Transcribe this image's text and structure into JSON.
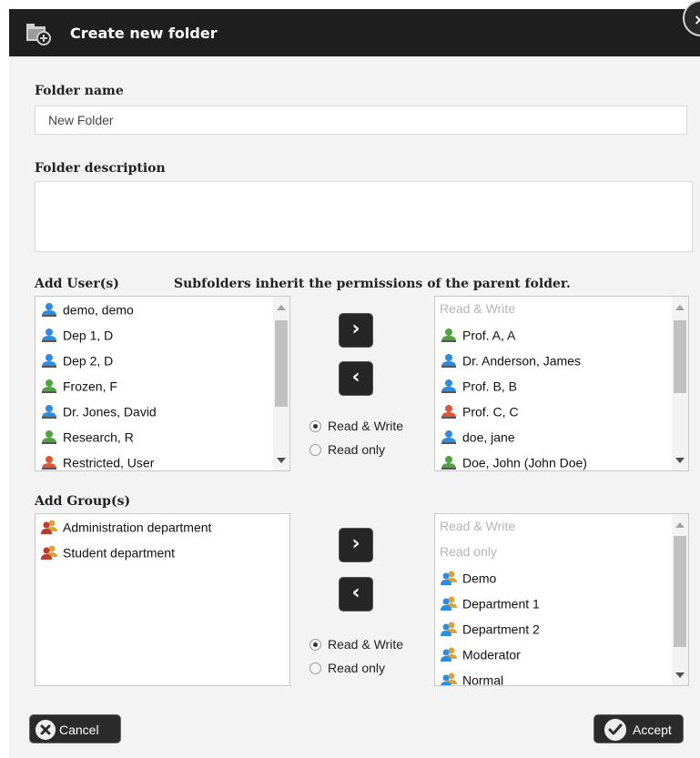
{
  "dialog": {
    "title": "Create new folder",
    "close_glyph": "×"
  },
  "folder_name": {
    "label": "Folder name",
    "value": "New Folder"
  },
  "folder_description": {
    "label": "Folder description",
    "value": ""
  },
  "users": {
    "label": "Add User(s)",
    "inherit_note": "Subfolders inherit the permissions of the parent folder.",
    "available": [
      {
        "name": "demo, demo",
        "role_color": "#2b8ce0"
      },
      {
        "name": "Dep 1, D",
        "role_color": "#2b8ce0"
      },
      {
        "name": "Dep 2, D",
        "role_color": "#2b8ce0"
      },
      {
        "name": "Frozen, F",
        "role_color": "#4ea43c"
      },
      {
        "name": "Dr. Jones, David",
        "role_color": "#2b8ce0"
      },
      {
        "name": "Research, R",
        "role_color": "#4ea43c"
      },
      {
        "name": "Restricted, User",
        "role_color": "#e0553a"
      }
    ],
    "assigned_header": "Read & Write",
    "assigned": [
      {
        "name": "Prof. A, A",
        "role_color": "#4ea43c"
      },
      {
        "name": "Dr. Anderson, James",
        "role_color": "#2b8ce0"
      },
      {
        "name": "Prof. B, B",
        "role_color": "#2b8ce0"
      },
      {
        "name": "Prof. C, C",
        "role_color": "#e0553a"
      },
      {
        "name": "doe, jane",
        "role_color": "#2b8ce0"
      },
      {
        "name": "Doe, John (John Doe)",
        "role_color": "#4ea43c"
      }
    ],
    "add_glyph": "›",
    "remove_glyph": "‹",
    "permission_options": [
      "Read & Write",
      "Read only"
    ],
    "selected_permission": "Read & Write"
  },
  "groups": {
    "label": "Add Group(s)",
    "available": [
      {
        "name": "Administration department",
        "role_color": "#c0392b"
      },
      {
        "name": "Student department",
        "role_color": "#c0392b"
      }
    ],
    "assigned_headers": [
      "Read & Write",
      "Read only"
    ],
    "assigned": [
      {
        "name": "Demo",
        "role_color": "#2b8ce0"
      },
      {
        "name": "Department 1",
        "role_color": "#2b8ce0"
      },
      {
        "name": "Department 2",
        "role_color": "#2b8ce0"
      },
      {
        "name": "Moderator",
        "role_color": "#2b8ce0"
      },
      {
        "name": "Normal",
        "role_color": "#2b8ce0"
      }
    ],
    "add_glyph": "›",
    "remove_glyph": "‹",
    "permission_options": [
      "Read & Write",
      "Read only"
    ],
    "selected_permission": "Read & Write"
  },
  "footer": {
    "cancel_label": "Cancel",
    "accept_label": "Accept"
  }
}
